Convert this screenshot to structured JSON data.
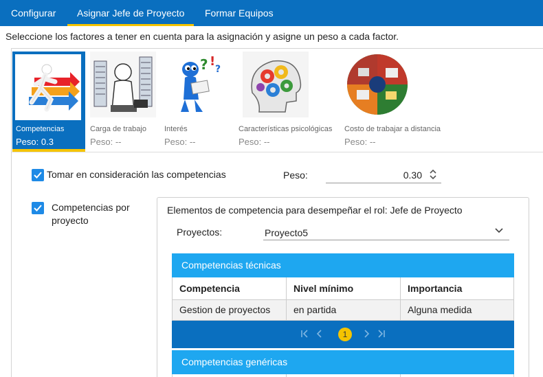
{
  "tabs": [
    {
      "label": "Configurar",
      "active": false
    },
    {
      "label": "Asignar Jefe de Proyecto",
      "active": true
    },
    {
      "label": "Formar Equipos",
      "active": false
    }
  ],
  "instruction": "Seleccione los factores a tener en cuenta para la asignación y asigne un peso a cada factor.",
  "factors": [
    {
      "name": "Competencias",
      "weight": "Peso: 0.3",
      "selected": true,
      "icon": "running-figure-arrows-icon"
    },
    {
      "name": "Carga de trabajo",
      "weight": "Peso: --",
      "selected": false,
      "icon": "overworked-person-icon"
    },
    {
      "name": "Interés",
      "weight": "Peso: --",
      "selected": false,
      "icon": "curious-figure-reading-icon"
    },
    {
      "name": "Características psicológicas",
      "weight": "Peso: --",
      "selected": false,
      "icon": "head-with-gears-icon"
    },
    {
      "name": "Costo de trabajar a distancia",
      "weight": "Peso: --",
      "selected": false,
      "icon": "remote-work-collage-icon"
    }
  ],
  "consider": {
    "label": "Tomar en consideración las competencias",
    "checked": true
  },
  "weight": {
    "label": "Peso:",
    "value": "0.30"
  },
  "by_project": {
    "label_line1": "Competencias por",
    "label_line2": "proyecto",
    "checked": true
  },
  "competency_box": {
    "title": "Elementos de competencia para desempeñar el rol: Jefe de Proyecto",
    "projects_label": "Proyectos:",
    "project_selected": "Proyecto5"
  },
  "technical": {
    "title": "Competencias técnicas",
    "columns": [
      "Competencia",
      "Nivel mínimo",
      "Importancia"
    ],
    "rows": [
      [
        "Gestion de proyectos",
        "en partida",
        "Alguna medida"
      ]
    ],
    "pager": {
      "current": "1"
    }
  },
  "generic": {
    "title": "Competencias genéricas"
  },
  "colors": {
    "nav": "#0a6fbf",
    "accent": "#f5c400",
    "grid_header": "#1ea7f0",
    "checkbox": "#1e8ae6"
  }
}
